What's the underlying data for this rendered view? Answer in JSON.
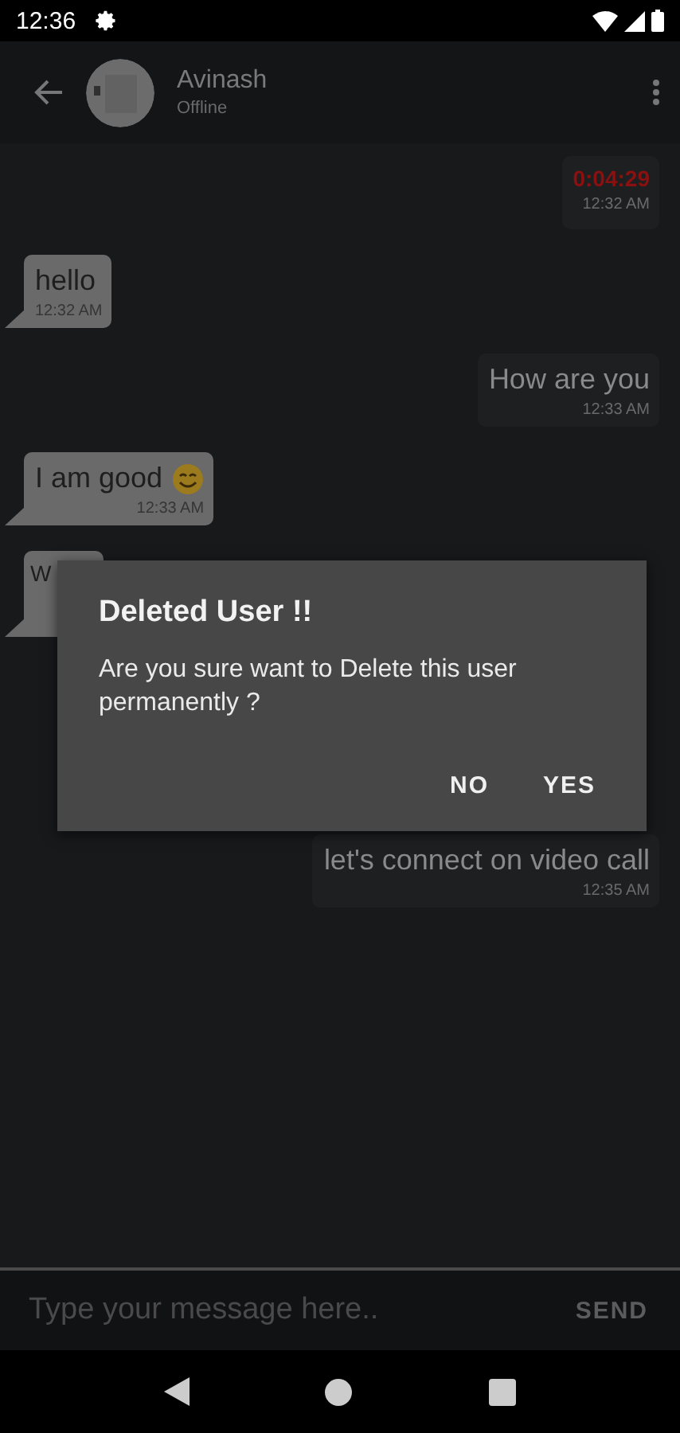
{
  "status_bar": {
    "time": "12:36"
  },
  "header": {
    "name": "Avinash",
    "status": "Offline"
  },
  "messages": [
    {
      "kind": "voice",
      "sent": true,
      "text": "0:04:29",
      "time": "12:32 AM"
    },
    {
      "kind": "text",
      "sent": false,
      "text": "hello",
      "time": "12:32 AM"
    },
    {
      "kind": "text",
      "sent": true,
      "text": "How are you",
      "time": "12:33 AM"
    },
    {
      "kind": "emoji",
      "sent": false,
      "text": "I am good",
      "time": "12:33 AM"
    },
    {
      "kind": "text",
      "sent": false,
      "text": "W"
    },
    {
      "kind": "text",
      "sent": true,
      "text": "let's connect on video call",
      "time": "12:35 AM"
    }
  ],
  "dialog": {
    "title": "Deleted User !!",
    "message": "Are you sure want to Delete this user permanently ?",
    "buttons": [
      "NO",
      "YES"
    ]
  },
  "composer": {
    "placeholder": "Type your message here..",
    "send": "SEND"
  }
}
